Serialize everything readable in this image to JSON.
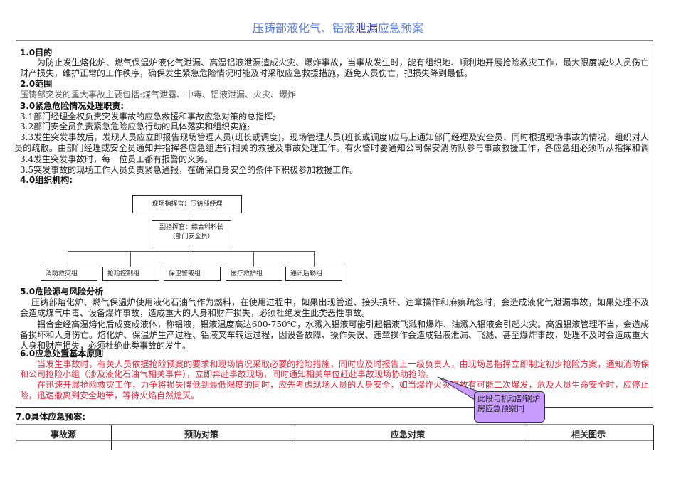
{
  "title": {
    "part1": "压铸部液化气、铝液",
    "part2": "泄漏",
    "part3": "应急预案"
  },
  "s1": {
    "heading": "1.0目的",
    "lines": [
      "为防止发生熔化炉、燃气保温炉液化气泄漏、高温铝液泄漏造成火灾、爆炸事故，当事故发生时，能有组织地、顺利地开展抢险救灾工作，最大限度减少人员伤亡及",
      "财产损失，维护正常的工作秩序，确保发生紧急危险情况时能及时采取应急救援措施，避免人员伤亡，把损失降到最低。"
    ]
  },
  "s2": {
    "heading": "2.0范围",
    "text": "压铸部突发的重大事故主要包括:煤气泄露、中毒、铝液泄漏、火灾、爆炸"
  },
  "s3": {
    "heading": "3.0紧急危险情况处理职责:",
    "lines": [
      "3.1部门经理全权负责突发事故的应急救援和事故应急对策的总指挥;",
      "3.2部门安全员负责紧急危险应急行动的具体落实和组织实施;",
      "3.3发生突发事故后，发现人员应立即报告现场管理人员(班长或调度)，现场管理人员(班长或调度)应马上通知部门经理及安全员、同时根据现场事故的情况，组织对人",
      "员的疏散。由部门经理或安全员通知并指挥各应急组进行相关的救援及事故处理工作。有火警时要通知公司保安消防队参与事故救援工作，各应急组必须听从指挥和调遣。",
      "3.4发生突发事故时，每一位员工都有报警的义务。",
      "3.5突发事故的现场工作人员负责紧急通报，在确保自身安全的条件下积极参加救援工作。"
    ]
  },
  "s4": {
    "heading": "4.0组织机构:",
    "org": {
      "top": "现场指挥官：压铸部经理",
      "deputy1": "副指挥官：综合科科长",
      "deputy2": "（部门安全员）",
      "groups": [
        "消防救灾组",
        "抢险控制组",
        "保卫警戒组",
        "医疗救护组",
        "通讯后勤组"
      ]
    }
  },
  "s5": {
    "heading": "5.0危险源与风险分析",
    "lines": [
      "压铸部熔化炉、燃气保温炉使用液化石油气作为燃料，在使用过程中，如果出现管道、接头损坏、违章操作和麻痹疏忽时，会造成液化气泄漏事故，如果处理不及时，",
      "会造成煤气中毒、设备爆炸事故，造成重大的人身和财产损失，必须杜绝发生此类恶性事故。",
      "铝合金经高温熔化后成变成液体，称铝液，铝液温度高达600-750℃，水溅入铝液可能引起铝液飞溅和爆炸、油溅入铝液会引起火灾。高温铝液管理不当，会造成设",
      "备损坏和人身伤亡。熔化炉、保温炉生产过程、铝液叉车转运过程，因设备故障、操作失误、违章操作会造成铝液泄漏、飞溅、甚至爆炸事故，处理不及时会造成重大的",
      "人身和财产损失，必须杜绝此类事故的发生。"
    ]
  },
  "s6": {
    "heading": "6.0应急处置基本原则",
    "lines": [
      "当发生事故时，有关人员依据抢险预案的要求和现场情况采取必要的抢险措施，同时应及时报告上一级负责人，由现场总指挥立即制定初步抢险方案，通知消防保安",
      "和公司抢险小组（涉及液化石油气相关事件），立即奔赴事故现场，同时通知相关单位赶赴事故现场协助抢险。",
      "在迅速开展抢险救灾工作，力争将损失降低到最低限度的同时，应先考虑现场人员的人身安全，如当爆炸火灾事故有可能二次爆发，危及人员生命安全时，应停止抢",
      "险，迅速撤离到安全地带，等待火焰自然熄灭。"
    ]
  },
  "callout": {
    "text": "此段与机动部锅炉房应急预案同",
    "color": "#c79bff"
  },
  "s7": {
    "heading": "7.0具体应急预案:",
    "columns": [
      "事故源",
      "预防对策",
      "应急对策",
      "相关图示"
    ]
  }
}
